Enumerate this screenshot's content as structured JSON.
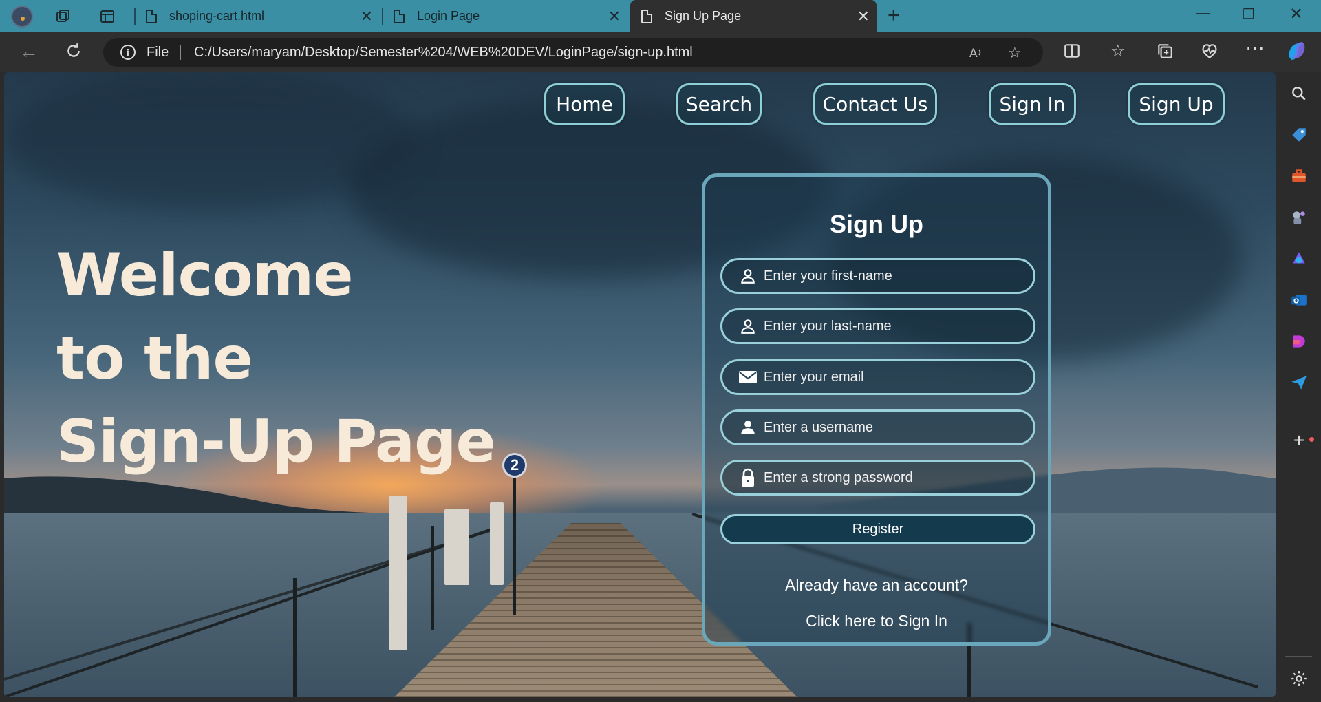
{
  "browser": {
    "tabs": [
      {
        "title": "shoping-cart.html"
      },
      {
        "title": "Login Page"
      },
      {
        "title": "Sign Up Page"
      }
    ],
    "address": {
      "scheme_label": "File",
      "url": "C:/Users/maryam/Desktop/Semester%204/WEB%20DEV/LoginPage/sign-up.html"
    },
    "icons": {
      "read_aloud": "read-aloud-icon",
      "favorite": "star-icon",
      "split": "split-screen-icon",
      "favorites": "favorites-icon",
      "collections": "collections-icon",
      "health": "browser-essentials-icon",
      "more": "more-icon"
    },
    "colors": {
      "tab_strip": "#3a8fa4",
      "toolbar": "#2f2f2f"
    }
  },
  "page": {
    "nav": [
      "Home",
      "Search",
      "Contact Us",
      "Sign In",
      "Sign Up"
    ],
    "welcome": {
      "line1": "Welcome",
      "line2": "to the",
      "line3": "Sign-Up Page"
    },
    "sign_up": {
      "title": "Sign Up",
      "fields": [
        {
          "placeholder": "Enter your first-name",
          "icon": "user-icon"
        },
        {
          "placeholder": "Enter your last-name",
          "icon": "user-icon"
        },
        {
          "placeholder": "Enter your email",
          "icon": "envelope-icon"
        },
        {
          "placeholder": "Enter a username",
          "icon": "user-icon"
        },
        {
          "placeholder": "Enter a strong password",
          "icon": "lock-icon"
        }
      ],
      "register_label": "Register",
      "already_text": "Already have an account?",
      "sign_in_link": "Click here to Sign In"
    },
    "colors": {
      "heading": "#f7ead9",
      "card_border": "#6ba7bb",
      "button_bg": "#143a4e"
    }
  }
}
